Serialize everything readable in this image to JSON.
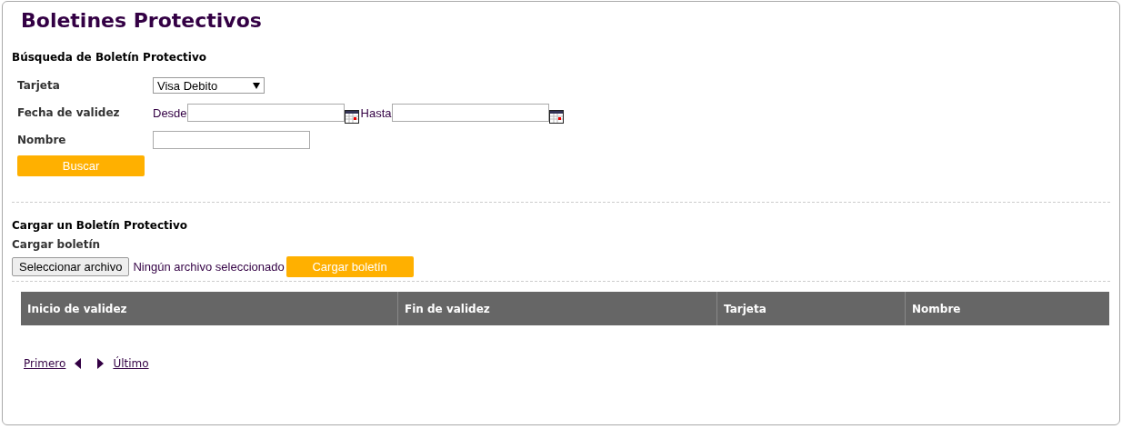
{
  "title": "Boletines Protectivos",
  "search": {
    "heading": "Búsqueda de Boletín Protectivo",
    "card": {
      "label": "Tarjeta",
      "value": "Visa Debito"
    },
    "validity": {
      "label": "Fecha de validez",
      "from_label": "Desde",
      "to_label": "Hasta"
    },
    "name": {
      "label": "Nombre"
    },
    "button": "Buscar"
  },
  "upload": {
    "heading": "Cargar un Boletín Protectivo",
    "label": "Cargar boletín",
    "file_button": "Seleccionar archivo",
    "file_status": "Ningún archivo seleccionado",
    "button": "Cargar boletín"
  },
  "table": {
    "columns": [
      "Inicio de validez",
      "Fin de validez",
      "Tarjeta",
      "Nombre"
    ]
  },
  "pager": {
    "first": "Primero",
    "last": "Último"
  }
}
